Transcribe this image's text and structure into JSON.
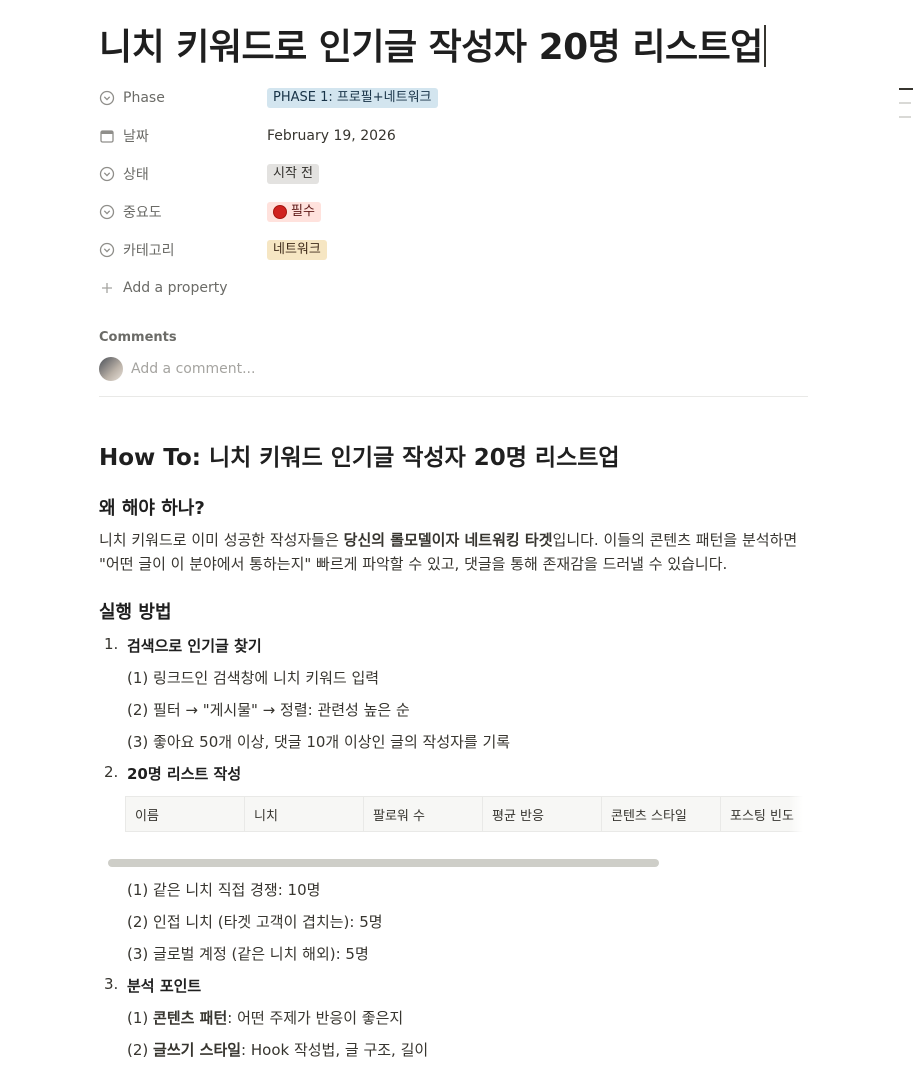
{
  "page": {
    "title": "니치 키워드로 인기글 작성자 20명 리스트업"
  },
  "properties": [
    {
      "key": "Phase",
      "icon": "select-icon",
      "value": "PHASE 1: 프로필+네트워크",
      "tag": "blue"
    },
    {
      "key": "날짜",
      "icon": "calendar-icon",
      "value": "February 19, 2026",
      "tag": ""
    },
    {
      "key": "상태",
      "icon": "select-icon",
      "value": "시작 전",
      "tag": "gray"
    },
    {
      "key": "중요도",
      "icon": "select-icon",
      "value": "필수",
      "tag": "red"
    },
    {
      "key": "카테고리",
      "icon": "select-icon",
      "value": "네트워크",
      "tag": "yellow"
    }
  ],
  "add_property_label": "Add a property",
  "comments": {
    "heading": "Comments",
    "placeholder": "Add a comment..."
  },
  "content": {
    "heading": "How To: 니치 키워드 인기글 작성자 20명 리스트업",
    "why_heading": "왜 해야 하나?",
    "why_text_1": "니치 키워드로 이미 성공한 작성자들은 ",
    "why_text_bold": "당신의 롤모델이자 네트워킹 타겟",
    "why_text_2": "입니다. 이들의 콘텐츠 패턴을 분석하면",
    "why_text_3": "\"어떤 글이 이 분야에서 통하는지\" 빠르게 파악할 수 있고, 댓글을 통해 존재감을 드러낼 수 있습니다.",
    "how_heading": "실행 방법",
    "steps": [
      {
        "num": "1.",
        "title": "검색으로 인기글 찾기"
      },
      {
        "num": "2.",
        "title": "20명 리스트 작성"
      },
      {
        "num": "3.",
        "title": "분석 포인트"
      }
    ],
    "step1_items": [
      "(1) 링크드인 검색창에 니치 키워드 입력",
      "(2) 필터 → \"게시물\" → 정렬: 관련성 높은 순",
      "(3) 좋아요 50개 이상, 댓글 10개 이상인 글의 작성자를 기록"
    ],
    "table_headers": [
      "이름",
      "니치",
      "팔로워 수",
      "평균 반응",
      "콘텐츠 스타일",
      "포스팅 빈도"
    ],
    "step2_items": [
      "(1) 같은 니치 직접 경쟁: 10명",
      "(2) 인접 니치 (타겟 고객이 겹치는): 5명",
      "(3) 글로벌 계정 (같은 니치 해외): 5명"
    ],
    "step3_items": [
      {
        "prefix": "(1) ",
        "bold": "콘텐츠 패턴",
        "rest": ": 어떤 주제가 반응이 좋은지"
      },
      {
        "prefix": "(2) ",
        "bold": "글쓰기 스타일",
        "rest": ": Hook 작성법, 글 구조, 길이"
      }
    ]
  }
}
